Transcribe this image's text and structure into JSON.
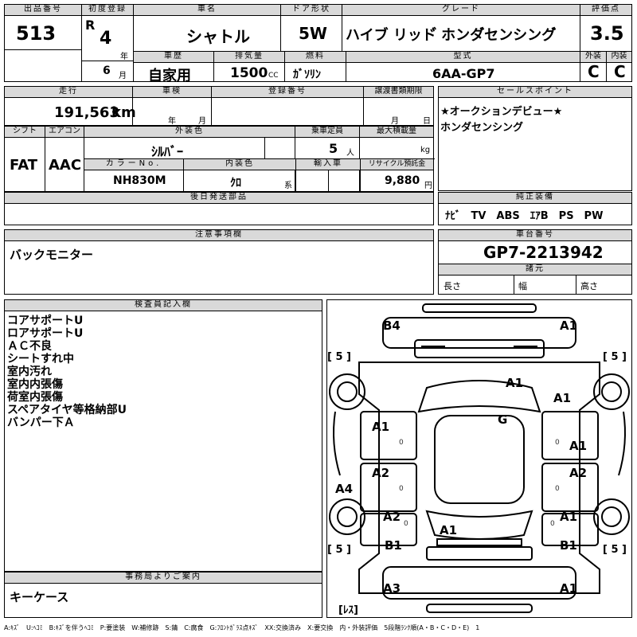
{
  "header": {
    "lot_label": "出品番号",
    "lot": "513",
    "first_reg_label": "初度登録",
    "era": "R",
    "year": "4",
    "year_unit": "年",
    "month": "6",
    "month_unit": "月",
    "name_label": "車名",
    "name": "シャトル",
    "door_label": "ドア形状",
    "door": "5W",
    "grade_label": "グレード",
    "grade": "ハイブ リッド゙ ホンダ゙センシング゙",
    "score_label": "評価点",
    "score": "3.5",
    "history_label": "車歴",
    "history": "自家用",
    "cc_label": "排気量",
    "cc": "1500",
    "cc_unit": "CC",
    "fuel_label": "燃料",
    "fuel": "ｶﾞｿﾘﾝ",
    "model_label": "型式",
    "model": "6AA-GP7",
    "ext_label": "外装",
    "ext": "C",
    "int_label": "内装",
    "int": "C"
  },
  "row2": {
    "mileage_label": "走行",
    "mileage": "191,563",
    "mileage_unit": "km",
    "inspection_label": "車検",
    "ins_year": "年",
    "ins_month": "月",
    "regno_label": "登録番号",
    "transfer_label": "譲渡書類期限",
    "tr_month": "月",
    "tr_day": "日",
    "sales_label": "セールスポイント",
    "sales_points": [
      "★オークションデビュー★",
      "ホンダセンシング"
    ]
  },
  "row3": {
    "shift_label": "シフト",
    "shift": "FAT",
    "ac_label": "エアコン",
    "ac": "AAC",
    "ext_color_label": "外装色",
    "ext_color": "ｼﾙﾊﾞｰ",
    "seats_label": "乗車定員",
    "seats": "5",
    "seats_unit": "人",
    "load_label": "最大積載量",
    "load_unit": "kg",
    "color_no_label": "カラーNo.",
    "color_no": "NH830M",
    "int_color_label": "内装色",
    "int_color": "ｸﾛ",
    "int_color_unit": "系",
    "import_label": "輸入車",
    "recycle_label": "リサイクル預託金",
    "recycle": "9,880",
    "recycle_unit": "円"
  },
  "row4": {
    "later_label": "後日発送部品",
    "equip_label": "純正装備",
    "equip": "ﾅﾋﾞ　TV　ABS　ｴｱB　PS　PW"
  },
  "notes": {
    "caution_label": "注意事項欄",
    "caution": "バックモニター",
    "chassis_label": "車台番号",
    "chassis": "GP7-2213942",
    "spec_label": "諸元",
    "length": "長さ",
    "width": "幅",
    "height": "高さ"
  },
  "inspector": {
    "label": "検査員記入欄",
    "items": [
      "コアサポートU",
      "ロアサポートU",
      "ＡＣ不良",
      "シートすれ中",
      "室内汚れ",
      "室内内張傷",
      "荷室内張傷",
      "スペアタイヤ等格納部U",
      "バンパー下Ａ"
    ]
  },
  "office": {
    "label": "事務局よりご案内",
    "text": "キーケース"
  },
  "diagram": {
    "tire_fl": "[ 5 ]",
    "tire_fr": "[ 5 ]",
    "tire_rl": "[ 5 ]",
    "tire_rr": "[ 5 ]",
    "spare": "[ﾚｽ]",
    "marks": [
      "B4",
      "A1",
      "A1",
      "A1",
      "G",
      "A1",
      "A1",
      "A2",
      "A2",
      "A4",
      "A2",
      "A1",
      "A1",
      "B1",
      "B1",
      "A3",
      "A1"
    ],
    "zeros": [
      "0",
      "0",
      "0",
      "0",
      "0",
      "0"
    ]
  },
  "legend": "A:ｷｽﾞ　U:ﾍｺﾐ　B:ｷｽﾞを伴うﾍｺﾐ　P:要塗装　W:補修跡　S:錆　C:腐食　G:ﾌﾛﾝﾄｶﾞﾗｽ点ｷｽﾞ　XX:交換済み　X:要交換　内・外装評価　5段階ﾗﾝｸ順(A・B・C・D・E)　1"
}
